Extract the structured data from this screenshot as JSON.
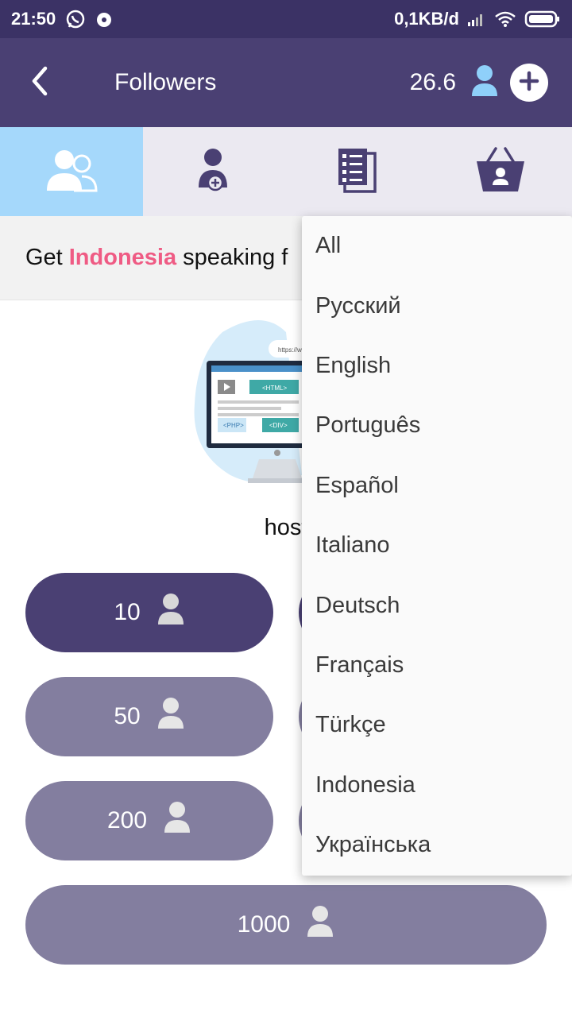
{
  "status_bar": {
    "time": "21:50",
    "speed": "0,1KB/d",
    "icons": [
      "whatsapp-icon",
      "music-icon",
      "signal-icon",
      "wifi-icon",
      "battery-icon"
    ]
  },
  "app_bar": {
    "title": "Followers",
    "balance": "26.6",
    "icons": [
      "back-arrow-icon",
      "person-icon",
      "plus-icon"
    ]
  },
  "tabs": [
    {
      "name": "followers",
      "icon": "users-icon",
      "active": true
    },
    {
      "name": "add-follower",
      "icon": "person-add-icon",
      "active": false
    },
    {
      "name": "orders",
      "icon": "list-icon",
      "active": false
    },
    {
      "name": "shop",
      "icon": "basket-icon",
      "active": false
    }
  ],
  "language_row": {
    "prefix": "Get",
    "language": "Indonesia",
    "suffix": "speaking f"
  },
  "site_name": "host",
  "illustration": {
    "url_text": "https://w",
    "html_tag": "<HTML>",
    "php_tag": "<PHP>",
    "div_tag": "<DIV>"
  },
  "order_buttons": [
    {
      "value": "10",
      "style": "dark"
    },
    {
      "value": "50",
      "style": "light"
    },
    {
      "value": "200",
      "style": "light"
    },
    {
      "value": "1000",
      "style": "light"
    }
  ],
  "dropdown": {
    "items": [
      "All",
      "Русский",
      "English",
      "Português",
      "Español",
      "Italiano",
      "Deutsch",
      "Français",
      "Türkçe",
      "Indonesia",
      "Українська"
    ]
  },
  "colors": {
    "status_bar": "#3b3265",
    "app_bar": "#4a4073",
    "active_tab": "#a5d8fb",
    "highlight": "#ef5b84",
    "button_dark": "#4a4073",
    "button_light": "#837e9f"
  }
}
